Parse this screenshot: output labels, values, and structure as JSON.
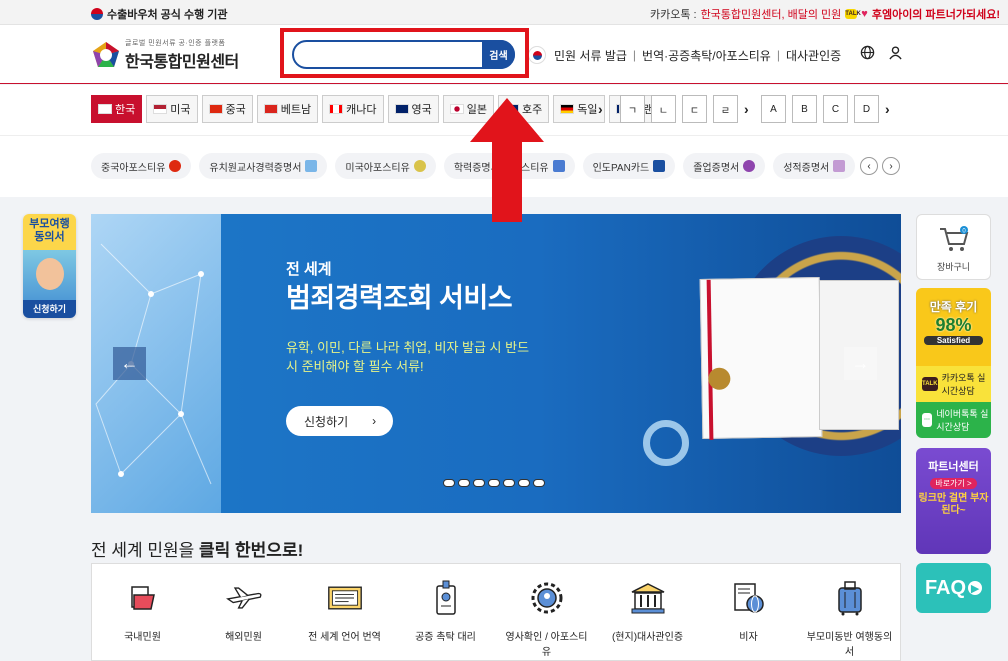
{
  "topbar": {
    "left_text": "수출바우처 공식 수행 기관",
    "kakao_label": "카카오톡 :",
    "kakao_text": "한국통합민원센터, 배달의 민원",
    "partner_text": "후엠아이의 파트너가되세요!"
  },
  "header": {
    "logo_sub": "글로벌 민원서류 공·인증 플랫폼",
    "logo_main": "한국통합민원센터",
    "search_placeholder": "",
    "search_button": "검색",
    "nav": [
      "민원 서류 발급",
      "번역·공증촉탁/아포스티유",
      "대사관인증"
    ]
  },
  "countries": [
    {
      "label": "한국",
      "flag": "#ffffff",
      "active": true
    },
    {
      "label": "미국",
      "flag": "#3c5aa6",
      "active": false
    },
    {
      "label": "중국",
      "flag": "#de2910",
      "active": false
    },
    {
      "label": "베트남",
      "flag": "#da251d",
      "active": false
    },
    {
      "label": "캐나다",
      "flag": "#ff0000",
      "active": false
    },
    {
      "label": "영국",
      "flag": "#012169",
      "active": false
    },
    {
      "label": "일본",
      "flag": "#ffffff",
      "active": false
    },
    {
      "label": "호주",
      "flag": "#012169",
      "active": false
    },
    {
      "label": "독일",
      "flag": "#000000",
      "active": false
    },
    {
      "label": "뉴질랜",
      "flag": "#012169",
      "active": false
    }
  ],
  "letters_kr": [
    "ㄱ",
    "ㄴ",
    "ㄷ",
    "ㄹ"
  ],
  "letters_en": [
    "A",
    "B",
    "C",
    "D"
  ],
  "chips": [
    {
      "label": "중국아포스티유",
      "color": "#de2910"
    },
    {
      "label": "유치원교사경력증명서",
      "color": "#7ab6e8"
    },
    {
      "label": "미국아포스티유",
      "color": "#d9c34a"
    },
    {
      "label": "학력증명서 아포스티유",
      "color": "#4a7bd1"
    },
    {
      "label": "인도PAN카드",
      "color": "#1a4fa0"
    },
    {
      "label": "졸업증명서",
      "color": "#8e44ad"
    },
    {
      "label": "성적증명서",
      "color": "#c39bd3"
    }
  ],
  "left_badge": {
    "top": "부모여행 동의서",
    "bottom": "신청하기"
  },
  "hero": {
    "sub_title": "전 세계",
    "title": "범죄경력조회 서비스",
    "desc": "유학, 이민, 다른 나라 취업, 비자 발급 시 반드시 준비해야 할 필수 서류!",
    "button": "신청하기",
    "arrow": "›"
  },
  "right_sidebar": {
    "cart": "장바구니",
    "cart_count": "0",
    "review_a": "만족 후기",
    "review_b": "98%",
    "review_c": "Satisfied",
    "kakao": "카카오톡 실시간상담",
    "naver": "네이버톡톡 실시간상담",
    "partner_a": "파트너센터",
    "partner_b": "바로가기 >",
    "partner_c": "링크만 걸면 부자된다~",
    "faq": "FAQ"
  },
  "section": {
    "title_pre": "전 세계 민원을 ",
    "title_bold": "클릭 한번으로!"
  },
  "services": [
    "국내민원",
    "해외민원",
    "전 세계 언어 번역",
    "공증 촉탁 대리",
    "영사확인 / 아포스티유",
    "(현지)대사관인증",
    "비자",
    "부모미동반 여행동의서"
  ],
  "colors": {
    "brand_red": "#c8102e",
    "brand_blue": "#1a4fa0",
    "highlight_red": "#e1141b"
  }
}
